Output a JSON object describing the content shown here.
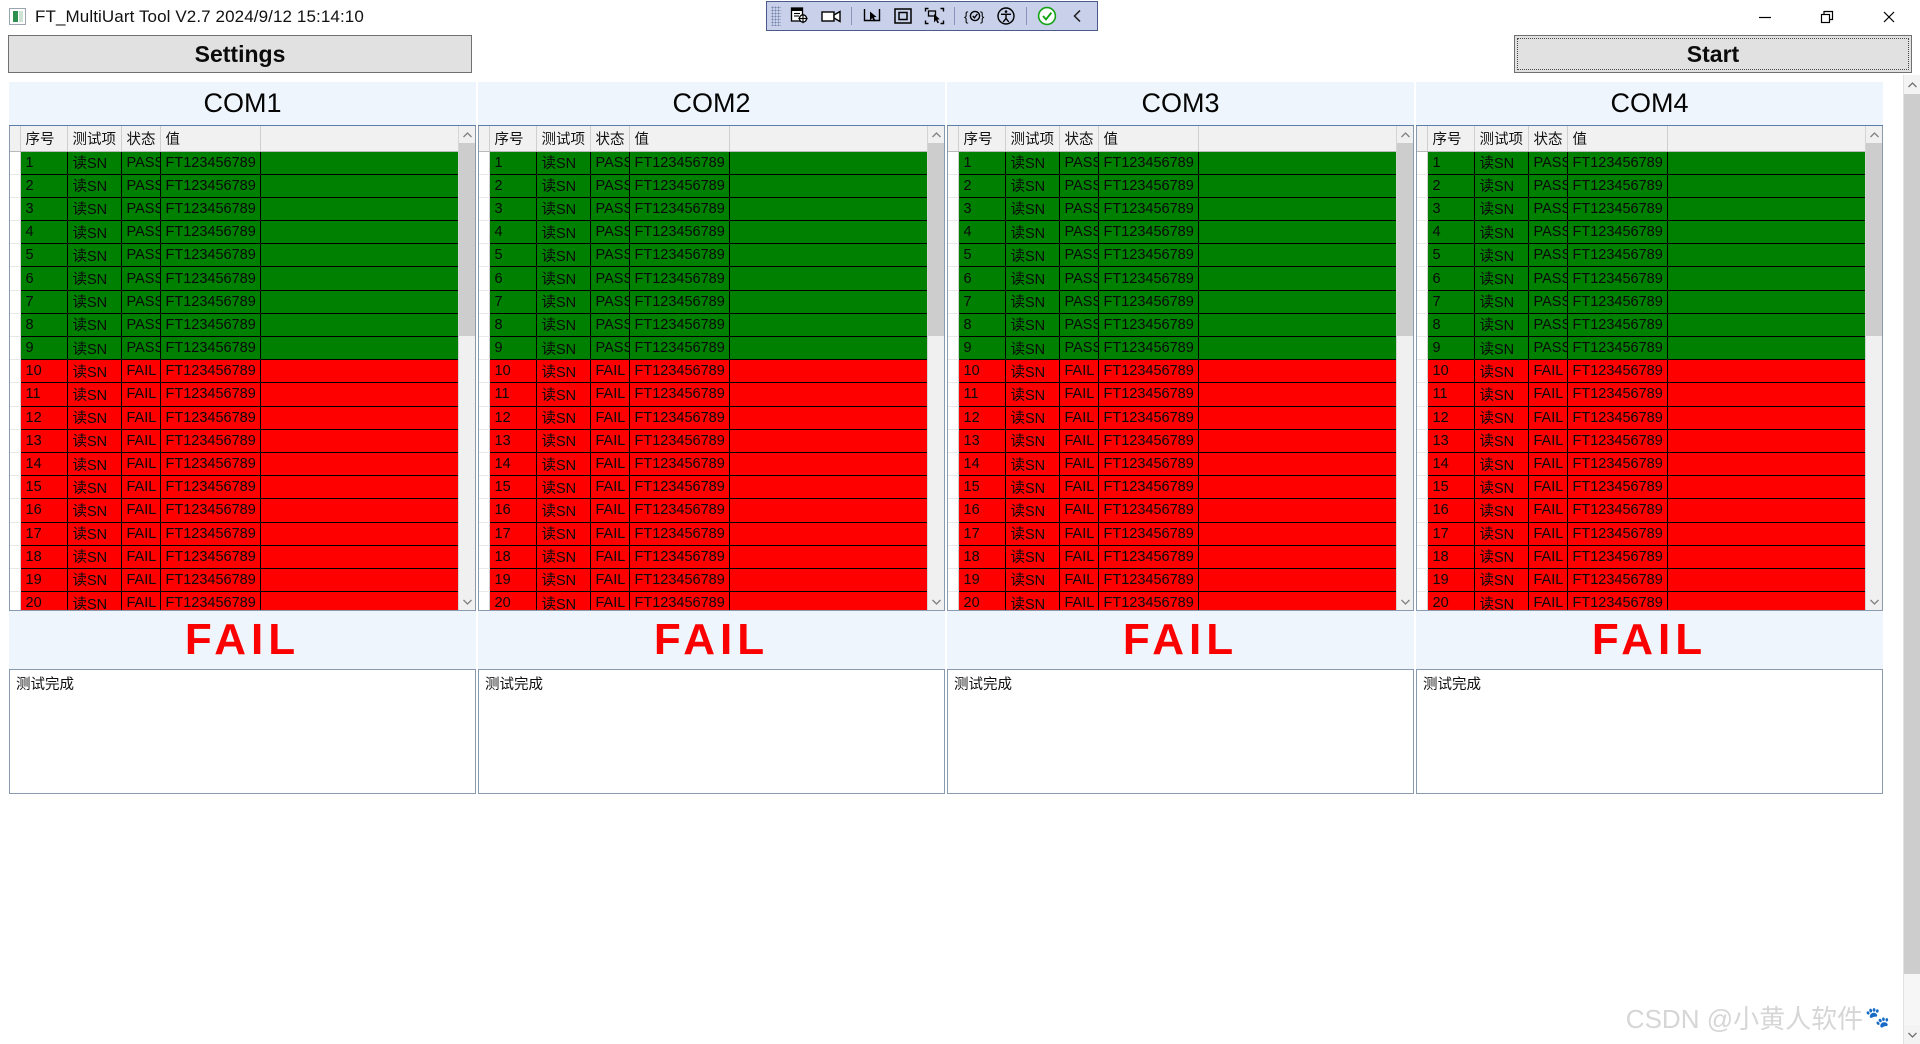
{
  "window": {
    "title": "FT_MultiUart Tool V2.7   2024/9/12 15:14:10",
    "app_icon": "app-icon",
    "controls": [
      {
        "name": "minimize-button",
        "glyph": "minimize-icon"
      },
      {
        "name": "restore-button",
        "glyph": "restore-icon"
      },
      {
        "name": "close-button",
        "glyph": "close-icon"
      }
    ]
  },
  "capture_toolbar": {
    "items": [
      {
        "name": "drag-handle-icon"
      },
      {
        "name": "capture-region-icon"
      },
      {
        "name": "record-video-icon"
      },
      {
        "name": "separator"
      },
      {
        "name": "cursor-select-icon"
      },
      {
        "name": "capture-window-icon"
      },
      {
        "name": "capture-element-icon"
      },
      {
        "name": "separator"
      },
      {
        "name": "code-inspect-icon"
      },
      {
        "name": "accessibility-icon"
      },
      {
        "name": "separator"
      },
      {
        "name": "confirm-check-icon"
      },
      {
        "name": "collapse-chevron-icon"
      }
    ]
  },
  "toolbar": {
    "settings_label": "Settings",
    "start_label": "Start"
  },
  "grid": {
    "headers": [
      "序号",
      "测试项",
      "状态",
      "值",
      ""
    ],
    "pass_color": "#008000",
    "fail_color": "#ff0000",
    "rows": [
      {
        "index": "1",
        "item": "读SN",
        "state": "PASS",
        "value": "FT123456789",
        "extra": "",
        "status": "pass"
      },
      {
        "index": "2",
        "item": "读SN",
        "state": "PASS",
        "value": "FT123456789",
        "extra": "",
        "status": "pass"
      },
      {
        "index": "3",
        "item": "读SN",
        "state": "PASS",
        "value": "FT123456789",
        "extra": "",
        "status": "pass"
      },
      {
        "index": "4",
        "item": "读SN",
        "state": "PASS",
        "value": "FT123456789",
        "extra": "",
        "status": "pass"
      },
      {
        "index": "5",
        "item": "读SN",
        "state": "PASS",
        "value": "FT123456789",
        "extra": "",
        "status": "pass"
      },
      {
        "index": "6",
        "item": "读SN",
        "state": "PASS",
        "value": "FT123456789",
        "extra": "",
        "status": "pass"
      },
      {
        "index": "7",
        "item": "读SN",
        "state": "PASS",
        "value": "FT123456789",
        "extra": "",
        "status": "pass"
      },
      {
        "index": "8",
        "item": "读SN",
        "state": "PASS",
        "value": "FT123456789",
        "extra": "",
        "status": "pass"
      },
      {
        "index": "9",
        "item": "读SN",
        "state": "PASS",
        "value": "FT123456789",
        "extra": "",
        "status": "pass"
      },
      {
        "index": "10",
        "item": "读SN",
        "state": "FAIL",
        "value": "FT123456789",
        "extra": "",
        "status": "fail"
      },
      {
        "index": "11",
        "item": "读SN",
        "state": "FAIL",
        "value": "FT123456789",
        "extra": "",
        "status": "fail"
      },
      {
        "index": "12",
        "item": "读SN",
        "state": "FAIL",
        "value": "FT123456789",
        "extra": "",
        "status": "fail"
      },
      {
        "index": "13",
        "item": "读SN",
        "state": "FAIL",
        "value": "FT123456789",
        "extra": "",
        "status": "fail"
      },
      {
        "index": "14",
        "item": "读SN",
        "state": "FAIL",
        "value": "FT123456789",
        "extra": "",
        "status": "fail"
      },
      {
        "index": "15",
        "item": "读SN",
        "state": "FAIL",
        "value": "FT123456789",
        "extra": "",
        "status": "fail"
      },
      {
        "index": "16",
        "item": "读SN",
        "state": "FAIL",
        "value": "FT123456789",
        "extra": "",
        "status": "fail"
      },
      {
        "index": "17",
        "item": "读SN",
        "state": "FAIL",
        "value": "FT123456789",
        "extra": "",
        "status": "fail"
      },
      {
        "index": "18",
        "item": "读SN",
        "state": "FAIL",
        "value": "FT123456789",
        "extra": "",
        "status": "fail"
      },
      {
        "index": "19",
        "item": "读SN",
        "state": "FAIL",
        "value": "FT123456789",
        "extra": "",
        "status": "fail"
      },
      {
        "index": "20",
        "item": "读SN",
        "state": "FAIL",
        "value": "FT123456789",
        "extra": "",
        "status": "fail"
      }
    ]
  },
  "panels": [
    {
      "title": "COM1",
      "result": "FAIL",
      "log": "测试完成"
    },
    {
      "title": "COM2",
      "result": "FAIL",
      "log": "测试完成"
    },
    {
      "title": "COM3",
      "result": "FAIL",
      "log": "测试完成"
    },
    {
      "title": "COM4",
      "result": "FAIL",
      "log": "测试完成"
    }
  ],
  "watermark": {
    "text": "CSDN @小黄人软件"
  }
}
